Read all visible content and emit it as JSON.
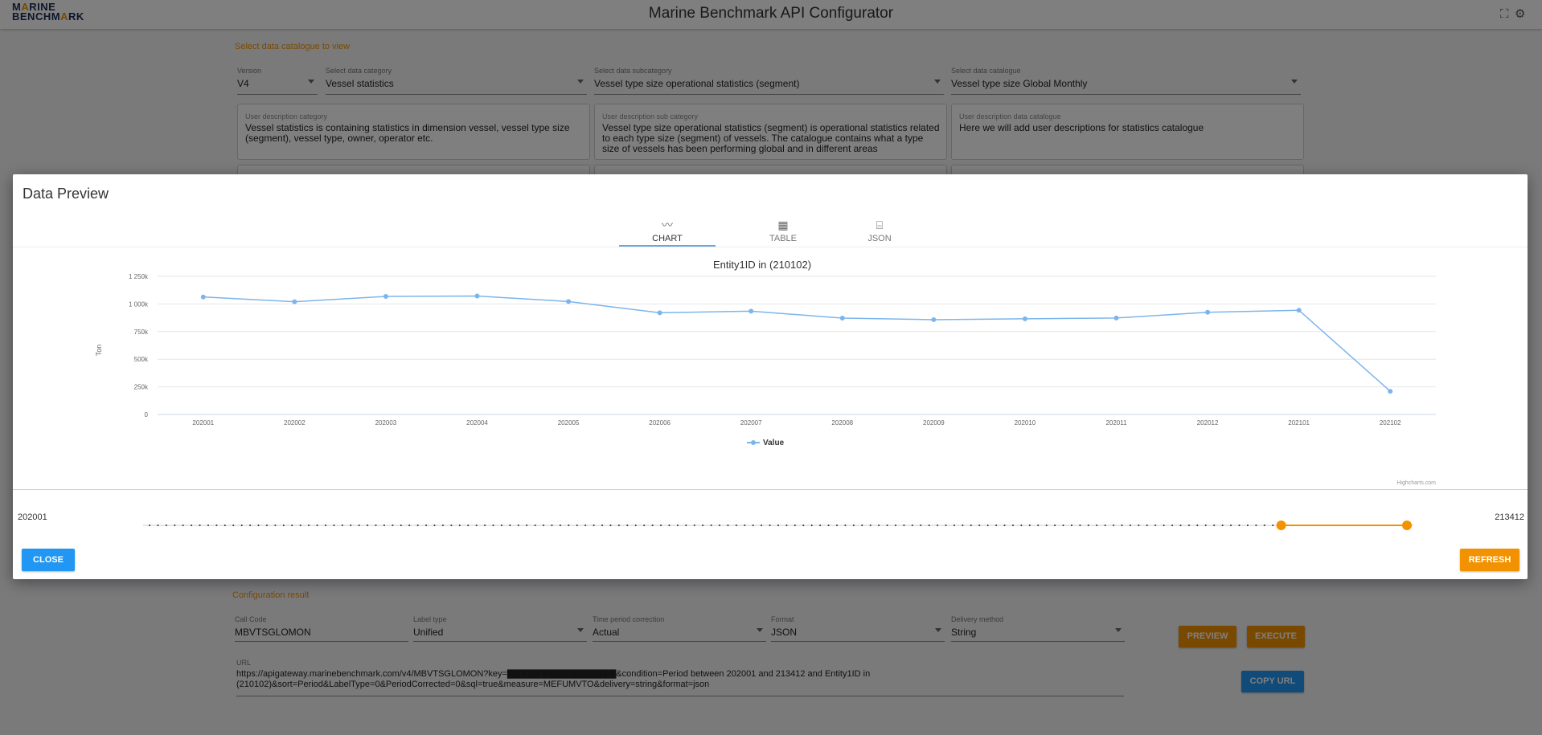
{
  "app": {
    "logo_line1_a": "M",
    "logo_line1_accent": "A",
    "logo_line1_b": "RINE",
    "logo_line2_a": "BENCHM",
    "logo_line2_accent": "A",
    "logo_line2_b": "RK",
    "title": "Marine Benchmark API Configurator",
    "icons": [
      "fullscreen-icon",
      "settings-icon"
    ]
  },
  "catalogue": {
    "section_label": "Select data catalogue to view",
    "version": {
      "label": "Version",
      "value": "V4"
    },
    "category": {
      "label": "Select data category",
      "value": "Vessel statistics"
    },
    "subcategory": {
      "label": "Select data subcategory",
      "value": "Vessel type size operational statistics (segment)"
    },
    "catalogue": {
      "label": "Select data catalogue",
      "value": "Vessel type size Global Monthly"
    },
    "desc_category": {
      "label": "User description category",
      "text": "Vessel statistics is containing statistics in dimension vessel, vessel type size (segment), vessel type, owner, operator etc."
    },
    "desc_subcategory": {
      "label": "User description sub category",
      "text": "Vessel type size operational statistics (segment) is operational statistics related to each type size (segment) of vessels. The catalogue contains what a type size of vessels has been performing global and in different areas"
    },
    "desc_catalogue": {
      "label": "User description data catalogue",
      "text": "Here we will add user descriptions for statistics catalogue"
    }
  },
  "config": {
    "section_label": "Configuration result",
    "call_code": {
      "label": "Call Code",
      "value": "MBVTSGLOMON"
    },
    "label_type": {
      "label": "Label type",
      "value": "Unified"
    },
    "time_period": {
      "label": "Time period correction",
      "value": "Actual"
    },
    "format": {
      "label": "Format",
      "value": "JSON"
    },
    "delivery": {
      "label": "Delivery method",
      "value": "String"
    },
    "preview_label": "PREVIEW",
    "execute_label": "EXECUTE",
    "url_label": "URL",
    "url_value": "https://apigateway.marinebenchmark.com/v4/MBVTSGLOMON?key=▇▇▇▇▇▇▇▇▇▇▇▇▇▇▇▇&condition=Period between 202001 and 213412 and Entity1ID in (210102)&sort=Period&LabelType=0&PeriodCorrected=0&sql=true&measure=MEFUMVTO&delivery=string&format=json",
    "copy_url_label": "COPY URL"
  },
  "modal": {
    "title": "Data Preview",
    "tabs": [
      {
        "label": "CHART",
        "icon": "line-chart-icon",
        "active": true
      },
      {
        "label": "TABLE",
        "icon": "table-icon",
        "active": false
      },
      {
        "label": "JSON",
        "icon": "json-icon",
        "active": false
      }
    ],
    "range_start": "202001",
    "range_end": "213412",
    "range_selected_fraction": [
      0.9,
      1.0
    ],
    "close_label": "CLOSE",
    "refresh_label": "REFRESH"
  },
  "chart_data": {
    "type": "line",
    "title": "Entity1ID in (210102)",
    "ylabel": "Ton",
    "xlabel": "",
    "categories": [
      "202001",
      "202002",
      "202003",
      "202004",
      "202005",
      "202006",
      "202007",
      "202008",
      "202009",
      "202010",
      "202011",
      "202012",
      "202101",
      "202102"
    ],
    "series": [
      {
        "name": "Value",
        "color": "#7cb5ec",
        "values": [
          1063000,
          1020000,
          1068000,
          1072000,
          1022000,
          920000,
          935000,
          872000,
          858000,
          866000,
          873000,
          925000,
          943000,
          210000
        ]
      }
    ],
    "ylim": [
      0,
      1250000
    ],
    "yticks": [
      "0",
      "250k",
      "500k",
      "750k",
      "1 000k",
      "1 250k"
    ],
    "yticks_values": [
      0,
      250000,
      500000,
      750000,
      1000000,
      1250000
    ],
    "legend": "bottom-center",
    "credits": "Highcharts.com",
    "grid": true
  }
}
